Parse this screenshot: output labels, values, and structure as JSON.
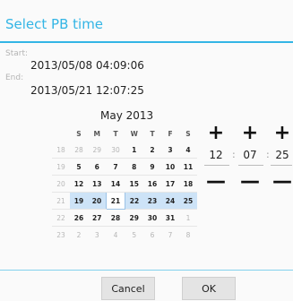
{
  "dialog": {
    "title": "Select PB time",
    "start_label": "Start:",
    "start_value": "2013/05/08 04:09:06",
    "end_label": "End:",
    "end_value": "2013/05/21 12:07:25"
  },
  "calendar": {
    "month_label": "May 2013",
    "weekdays": [
      "S",
      "M",
      "T",
      "W",
      "T",
      "F",
      "S"
    ],
    "weeks": [
      {
        "wk": "18",
        "days": [
          "28",
          "29",
          "30",
          "1",
          "2",
          "3",
          "4"
        ]
      },
      {
        "wk": "19",
        "days": [
          "5",
          "6",
          "7",
          "8",
          "9",
          "10",
          "11"
        ]
      },
      {
        "wk": "20",
        "days": [
          "12",
          "13",
          "14",
          "15",
          "16",
          "17",
          "18"
        ]
      },
      {
        "wk": "21",
        "days": [
          "19",
          "20",
          "21",
          "22",
          "23",
          "24",
          "25"
        ]
      },
      {
        "wk": "22",
        "days": [
          "26",
          "27",
          "28",
          "29",
          "30",
          "31",
          "1"
        ]
      },
      {
        "wk": "23",
        "days": [
          "2",
          "3",
          "4",
          "5",
          "6",
          "7",
          "8"
        ]
      }
    ]
  },
  "time": {
    "hour": "12",
    "minute": "07",
    "second": "25",
    "separator": ":",
    "plus_symbol": "+",
    "minus_symbol": "—"
  },
  "buttons": {
    "cancel_label": "Cancel",
    "ok_label": "OK"
  }
}
